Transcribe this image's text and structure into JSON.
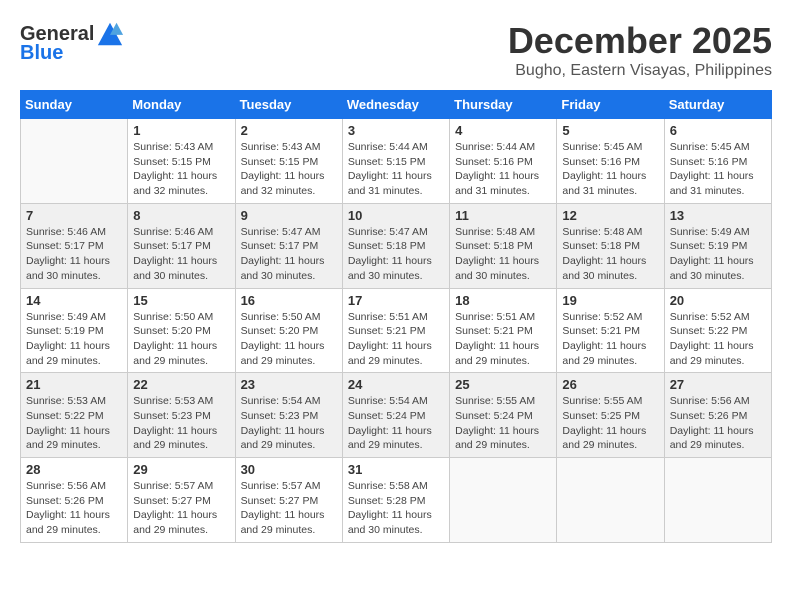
{
  "header": {
    "logo_general": "General",
    "logo_blue": "Blue",
    "month": "December 2025",
    "location": "Bugho, Eastern Visayas, Philippines"
  },
  "weekdays": [
    "Sunday",
    "Monday",
    "Tuesday",
    "Wednesday",
    "Thursday",
    "Friday",
    "Saturday"
  ],
  "weeks": [
    [
      {
        "day": "",
        "info": ""
      },
      {
        "day": "1",
        "info": "Sunrise: 5:43 AM\nSunset: 5:15 PM\nDaylight: 11 hours\nand 32 minutes."
      },
      {
        "day": "2",
        "info": "Sunrise: 5:43 AM\nSunset: 5:15 PM\nDaylight: 11 hours\nand 32 minutes."
      },
      {
        "day": "3",
        "info": "Sunrise: 5:44 AM\nSunset: 5:15 PM\nDaylight: 11 hours\nand 31 minutes."
      },
      {
        "day": "4",
        "info": "Sunrise: 5:44 AM\nSunset: 5:16 PM\nDaylight: 11 hours\nand 31 minutes."
      },
      {
        "day": "5",
        "info": "Sunrise: 5:45 AM\nSunset: 5:16 PM\nDaylight: 11 hours\nand 31 minutes."
      },
      {
        "day": "6",
        "info": "Sunrise: 5:45 AM\nSunset: 5:16 PM\nDaylight: 11 hours\nand 31 minutes."
      }
    ],
    [
      {
        "day": "7",
        "info": "Sunrise: 5:46 AM\nSunset: 5:17 PM\nDaylight: 11 hours\nand 30 minutes."
      },
      {
        "day": "8",
        "info": "Sunrise: 5:46 AM\nSunset: 5:17 PM\nDaylight: 11 hours\nand 30 minutes."
      },
      {
        "day": "9",
        "info": "Sunrise: 5:47 AM\nSunset: 5:17 PM\nDaylight: 11 hours\nand 30 minutes."
      },
      {
        "day": "10",
        "info": "Sunrise: 5:47 AM\nSunset: 5:18 PM\nDaylight: 11 hours\nand 30 minutes."
      },
      {
        "day": "11",
        "info": "Sunrise: 5:48 AM\nSunset: 5:18 PM\nDaylight: 11 hours\nand 30 minutes."
      },
      {
        "day": "12",
        "info": "Sunrise: 5:48 AM\nSunset: 5:18 PM\nDaylight: 11 hours\nand 30 minutes."
      },
      {
        "day": "13",
        "info": "Sunrise: 5:49 AM\nSunset: 5:19 PM\nDaylight: 11 hours\nand 30 minutes."
      }
    ],
    [
      {
        "day": "14",
        "info": "Sunrise: 5:49 AM\nSunset: 5:19 PM\nDaylight: 11 hours\nand 29 minutes."
      },
      {
        "day": "15",
        "info": "Sunrise: 5:50 AM\nSunset: 5:20 PM\nDaylight: 11 hours\nand 29 minutes."
      },
      {
        "day": "16",
        "info": "Sunrise: 5:50 AM\nSunset: 5:20 PM\nDaylight: 11 hours\nand 29 minutes."
      },
      {
        "day": "17",
        "info": "Sunrise: 5:51 AM\nSunset: 5:21 PM\nDaylight: 11 hours\nand 29 minutes."
      },
      {
        "day": "18",
        "info": "Sunrise: 5:51 AM\nSunset: 5:21 PM\nDaylight: 11 hours\nand 29 minutes."
      },
      {
        "day": "19",
        "info": "Sunrise: 5:52 AM\nSunset: 5:21 PM\nDaylight: 11 hours\nand 29 minutes."
      },
      {
        "day": "20",
        "info": "Sunrise: 5:52 AM\nSunset: 5:22 PM\nDaylight: 11 hours\nand 29 minutes."
      }
    ],
    [
      {
        "day": "21",
        "info": "Sunrise: 5:53 AM\nSunset: 5:22 PM\nDaylight: 11 hours\nand 29 minutes."
      },
      {
        "day": "22",
        "info": "Sunrise: 5:53 AM\nSunset: 5:23 PM\nDaylight: 11 hours\nand 29 minutes."
      },
      {
        "day": "23",
        "info": "Sunrise: 5:54 AM\nSunset: 5:23 PM\nDaylight: 11 hours\nand 29 minutes."
      },
      {
        "day": "24",
        "info": "Sunrise: 5:54 AM\nSunset: 5:24 PM\nDaylight: 11 hours\nand 29 minutes."
      },
      {
        "day": "25",
        "info": "Sunrise: 5:55 AM\nSunset: 5:24 PM\nDaylight: 11 hours\nand 29 minutes."
      },
      {
        "day": "26",
        "info": "Sunrise: 5:55 AM\nSunset: 5:25 PM\nDaylight: 11 hours\nand 29 minutes."
      },
      {
        "day": "27",
        "info": "Sunrise: 5:56 AM\nSunset: 5:26 PM\nDaylight: 11 hours\nand 29 minutes."
      }
    ],
    [
      {
        "day": "28",
        "info": "Sunrise: 5:56 AM\nSunset: 5:26 PM\nDaylight: 11 hours\nand 29 minutes."
      },
      {
        "day": "29",
        "info": "Sunrise: 5:57 AM\nSunset: 5:27 PM\nDaylight: 11 hours\nand 29 minutes."
      },
      {
        "day": "30",
        "info": "Sunrise: 5:57 AM\nSunset: 5:27 PM\nDaylight: 11 hours\nand 29 minutes."
      },
      {
        "day": "31",
        "info": "Sunrise: 5:58 AM\nSunset: 5:28 PM\nDaylight: 11 hours\nand 30 minutes."
      },
      {
        "day": "",
        "info": ""
      },
      {
        "day": "",
        "info": ""
      },
      {
        "day": "",
        "info": ""
      }
    ]
  ]
}
